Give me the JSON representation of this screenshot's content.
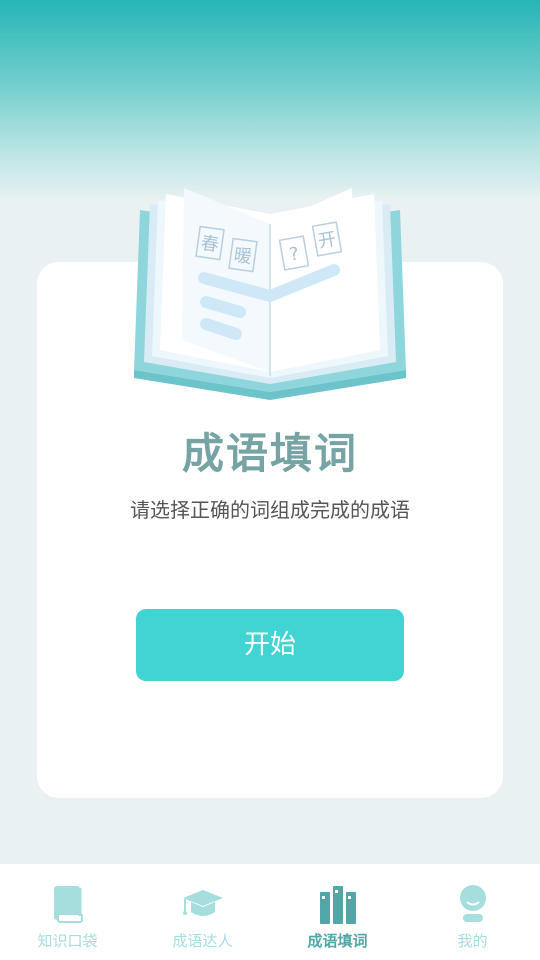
{
  "hero": {
    "title": "成语填词",
    "subtitle": "请选择正确的词组成完成的成语",
    "book_chars": [
      "春",
      "暖",
      "?",
      "开"
    ]
  },
  "action": {
    "start_label": "开始"
  },
  "tabbar": {
    "items": [
      {
        "label": "知识口袋",
        "icon": "book-icon",
        "active": false
      },
      {
        "label": "成语达人",
        "icon": "graduation-cap-icon",
        "active": false
      },
      {
        "label": "成语填词",
        "icon": "books-icon",
        "active": true
      },
      {
        "label": "我的",
        "icon": "user-icon",
        "active": false
      }
    ]
  },
  "colors": {
    "accent": "#41d4d3",
    "title": "#76a3a3",
    "tab_active": "#52a6a6",
    "tab_inactive": "#a6dede",
    "background": "#e9f1f3"
  }
}
